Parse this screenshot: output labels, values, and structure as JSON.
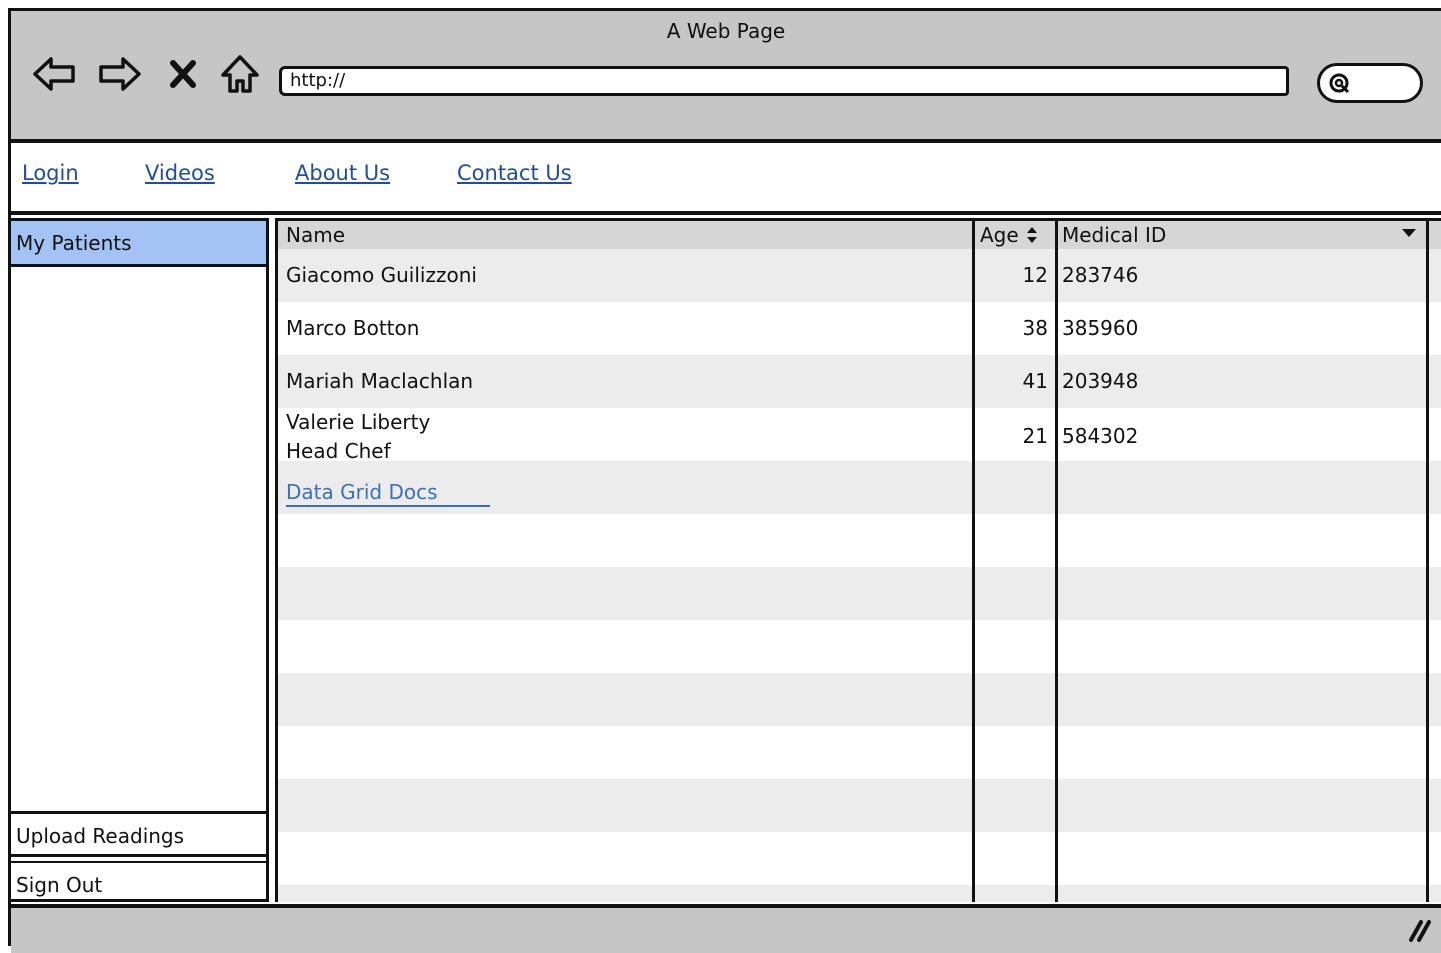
{
  "window": {
    "title": "A Web Page"
  },
  "toolbar": {
    "url_value": "http://",
    "buttons": [
      "back-arrow-icon",
      "forward-arrow-icon",
      "stop-icon",
      "home-icon",
      "search-icon"
    ]
  },
  "topnav": {
    "links": [
      {
        "label": "Login"
      },
      {
        "label": "Videos"
      },
      {
        "label": "About Us"
      },
      {
        "label": "Contact Us"
      }
    ]
  },
  "sidebar": {
    "items": [
      {
        "label": "My Patients",
        "selected": true
      },
      {
        "label": "Upload Readings",
        "selected": false
      },
      {
        "label": "Sign Out",
        "selected": false
      }
    ],
    "selected_color": "#a4c3f5"
  },
  "grid": {
    "columns": [
      {
        "label": "Name",
        "control": ""
      },
      {
        "label": "Age",
        "control": "sort-icon"
      },
      {
        "label": "Medical ID",
        "control": "dropdown-arrow-icon"
      }
    ],
    "rows": [
      {
        "name": "Giacomo Guilizzoni",
        "subtitle": "",
        "age": "12",
        "medical_id": "283746"
      },
      {
        "name": "Marco Botton",
        "subtitle": "",
        "age": "38",
        "medical_id": "385960"
      },
      {
        "name": "Mariah Maclachlan",
        "subtitle": "",
        "age": "41",
        "medical_id": "203948"
      },
      {
        "name": "Valerie Liberty",
        "subtitle": "Head Chef",
        "age": "21",
        "medical_id": "584302"
      }
    ],
    "link": "Data Grid Docs",
    "stripe_color": "#ececec",
    "header_color": "#d6d6d6"
  },
  "colors": {
    "chrome": "#c6c6c6",
    "link": "#1f4e9c"
  }
}
